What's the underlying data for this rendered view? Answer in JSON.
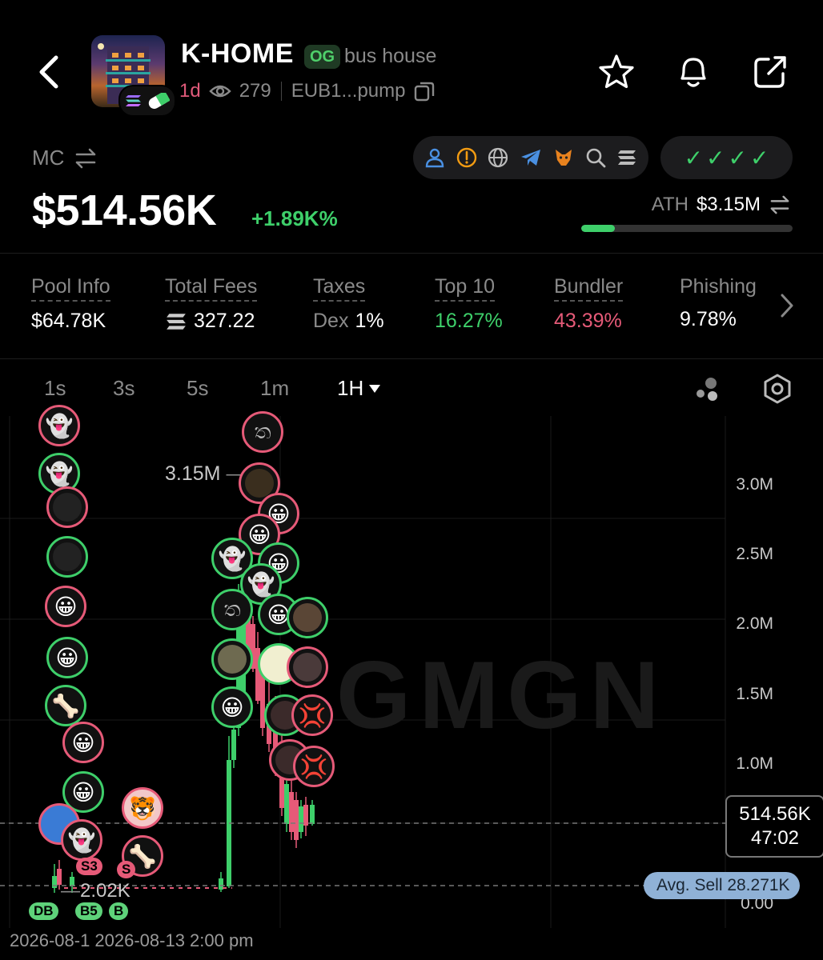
{
  "header": {
    "token_name": "K-HOME",
    "og_badge": "OG",
    "subtitle": "bus house",
    "age": "1d",
    "views": "279",
    "address": "EUB1...pump"
  },
  "market": {
    "label": "MC",
    "value": "$514.56K",
    "change": "+1.89K%",
    "ath_label": "ATH",
    "ath_value": "$3.15M",
    "ath_progress": 0.16
  },
  "stats": [
    {
      "label": "Pool Info",
      "value": "$64.78K",
      "color": "#ffffff"
    },
    {
      "label": "Total Fees",
      "value": "327.22",
      "color": "#ffffff"
    },
    {
      "label": "Taxes",
      "value_prefix": "Dex",
      "value": "1%",
      "color": "#ffffff"
    },
    {
      "label": "Top 10",
      "value": "16.27%",
      "color": "#3ecf6a"
    },
    {
      "label": "Bundler",
      "value": "43.39%",
      "color": "#e65a78"
    },
    {
      "label": "Phishing",
      "value": "9.78%",
      "color": "#ffffff"
    }
  ],
  "timeframes": [
    "1s",
    "3s",
    "5s",
    "1m",
    "1H"
  ],
  "active_timeframe": "1H",
  "chart": {
    "y_labels": [
      "3.0M",
      "2.5M",
      "2.0M",
      "1.5M",
      "1.0M",
      "0.00"
    ],
    "current_price": "514.56K",
    "countdown": "47:02",
    "avg_sell": "Avg. Sell 28.271K",
    "ath_mark": "3.15M",
    "low_mark": "2.02K",
    "watermark": "GMGN",
    "time_label": "2026-08-1 2026-08-13 2:00 pm",
    "tags": [
      "DB",
      "S3",
      "B5",
      "B",
      "S"
    ]
  },
  "colors": {
    "up": "#3ecf6a",
    "down": "#e65a78",
    "accent_blue": "#4a90e2"
  }
}
